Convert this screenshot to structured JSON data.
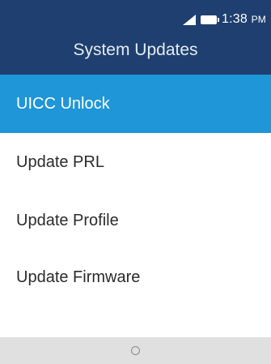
{
  "status": {
    "time": "1:38",
    "ampm": "PM",
    "icons": [
      "signal-icon",
      "battery-icon"
    ]
  },
  "header": {
    "title": "System Updates"
  },
  "menu": {
    "items": [
      {
        "label": "UICC Unlock",
        "selected": true
      },
      {
        "label": "Update PRL",
        "selected": false
      },
      {
        "label": "Update Profile",
        "selected": false
      },
      {
        "label": "Update Firmware",
        "selected": false
      }
    ]
  },
  "softkeys": {
    "center_icon": "home-circle-icon"
  },
  "colors": {
    "header_bg": "#1e3f6f",
    "selected_bg": "#1e96d8",
    "softkey_bg": "#e0e0e0"
  }
}
